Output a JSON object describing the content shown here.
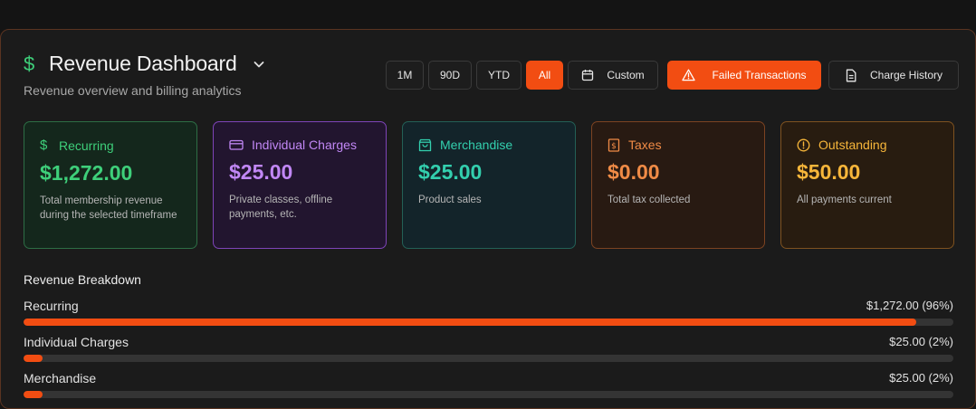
{
  "header": {
    "title": "Revenue Dashboard",
    "subtitle": "Revenue overview and billing analytics"
  },
  "toolbar": {
    "range_buttons": [
      "1M",
      "90D",
      "YTD",
      "All"
    ],
    "active_range": "All",
    "custom_label": "Custom",
    "failed_label": "Failed Transactions",
    "history_label": "Charge History"
  },
  "cards": [
    {
      "label": "Recurring",
      "amount": "$1,272.00",
      "desc": "Total membership revenue during the selected timeframe",
      "icon": "dollar-icon",
      "color": "#3ecf7a"
    },
    {
      "label": "Individual Charges",
      "amount": "$25.00",
      "desc": "Private classes, offline payments, etc.",
      "icon": "credit-card-icon",
      "color": "#c187f5"
    },
    {
      "label": "Merchandise",
      "amount": "$25.00",
      "desc": "Product sales",
      "icon": "shopping-bag-icon",
      "color": "#33cfae"
    },
    {
      "label": "Taxes",
      "amount": "$0.00",
      "desc": "Total tax collected",
      "icon": "receipt-icon",
      "color": "#f08b46"
    },
    {
      "label": "Outstanding",
      "amount": "$50.00",
      "desc": "All payments current",
      "icon": "alert-circle-icon",
      "color": "#f7b63a"
    }
  ],
  "breakdown": {
    "title": "Revenue Breakdown",
    "rows": [
      {
        "label": "Recurring",
        "value": "$1,272.00 (96%)",
        "percent": 96
      },
      {
        "label": "Individual Charges",
        "value": "$25.00 (2%)",
        "percent": 2
      },
      {
        "label": "Merchandise",
        "value": "$25.00 (2%)",
        "percent": 2
      }
    ]
  },
  "colors": {
    "accent": "#f24d12"
  }
}
